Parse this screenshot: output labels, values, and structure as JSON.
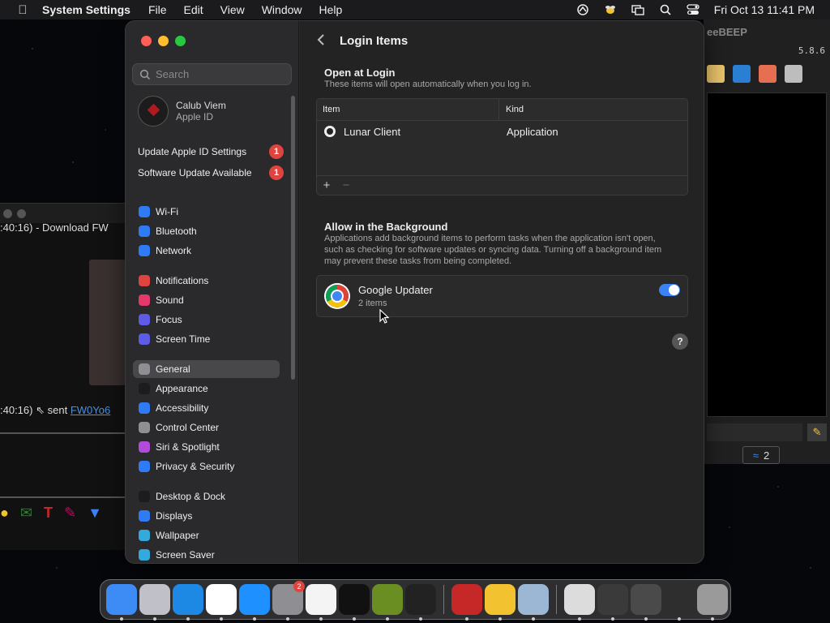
{
  "menubar": {
    "app_name": "System Settings",
    "menus": [
      "File",
      "Edit",
      "View",
      "Window",
      "Help"
    ],
    "clock": "Fri Oct 13  11:41 PM"
  },
  "background": {
    "left_window_line1": ":40:16)  -  Download FW",
    "left_window_line2_prefix": ":40:16)  ",
    "left_window_line2_sent": "sent ",
    "left_window_line2_link": "FW0Yo6",
    "right_window_title": "eeBEEP",
    "right_window_version": "5.8.6",
    "right_window_badge": "2"
  },
  "sidebar": {
    "search_placeholder": "Search",
    "user_name": "Calub Viem",
    "user_sub": "Apple ID",
    "notifications": [
      {
        "label": "Update Apple ID Settings",
        "count": "1"
      },
      {
        "label": "Software Update Available",
        "count": "1"
      }
    ],
    "items": [
      {
        "label": "Wi-Fi",
        "icon": "wifi-icon",
        "color": "#2f7bf6"
      },
      {
        "label": "Bluetooth",
        "icon": "bluetooth-icon",
        "color": "#2f7bf6"
      },
      {
        "label": "Network",
        "icon": "globe-icon",
        "color": "#2f7bf6"
      },
      {
        "label": "Notifications",
        "icon": "bell-icon",
        "color": "#e0443e"
      },
      {
        "label": "Sound",
        "icon": "speaker-icon",
        "color": "#e5396b"
      },
      {
        "label": "Focus",
        "icon": "moon-icon",
        "color": "#5e5ce6"
      },
      {
        "label": "Screen Time",
        "icon": "hourglass-icon",
        "color": "#5e5ce6"
      },
      {
        "label": "General",
        "icon": "gear-icon",
        "color": "#8e8e93"
      },
      {
        "label": "Appearance",
        "icon": "appearance-icon",
        "color": "#1c1c1e"
      },
      {
        "label": "Accessibility",
        "icon": "accessibility-icon",
        "color": "#2f7bf6"
      },
      {
        "label": "Control Center",
        "icon": "control-center-icon",
        "color": "#8e8e93"
      },
      {
        "label": "Siri & Spotlight",
        "icon": "siri-icon",
        "color": "#b04cd9"
      },
      {
        "label": "Privacy & Security",
        "icon": "hand-icon",
        "color": "#2f7bf6"
      },
      {
        "label": "Desktop & Dock",
        "icon": "dock-icon",
        "color": "#1c1c1e"
      },
      {
        "label": "Displays",
        "icon": "display-icon",
        "color": "#2f7bf6"
      },
      {
        "label": "Wallpaper",
        "icon": "wallpaper-icon",
        "color": "#34aadc"
      },
      {
        "label": "Screen Saver",
        "icon": "screensaver-icon",
        "color": "#34aadc"
      }
    ],
    "selected": "General"
  },
  "content": {
    "page_title": "Login Items",
    "open_at_login": {
      "title": "Open at Login",
      "description": "These items will open automatically when you log in.",
      "columns": [
        "Item",
        "Kind"
      ],
      "rows": [
        {
          "item": "Lunar Client",
          "kind": "Application"
        }
      ],
      "add_label": "+",
      "remove_label": "−"
    },
    "background": {
      "title": "Allow in the Background",
      "description": "Applications add background items to perform tasks when the application isn't open, such as checking for software updates or syncing data. Turning off a background item may prevent these tasks from being completed.",
      "item_name": "Google Updater",
      "item_sub": "2 items",
      "enabled": true
    },
    "help_label": "?"
  },
  "dock": {
    "apps": [
      {
        "name": "finder-icon",
        "color": "#3d8bf5"
      },
      {
        "name": "launchpad-icon",
        "color": "#c0c0c8"
      },
      {
        "name": "safari-icon",
        "color": "#1e88e5"
      },
      {
        "name": "chrome-icon",
        "color": "#ffffff"
      },
      {
        "name": "app-store-icon",
        "color": "#1e90ff"
      },
      {
        "name": "system-settings-icon",
        "color": "#8e8e93",
        "badge": "2"
      },
      {
        "name": "textedit-icon",
        "color": "#f4f4f4"
      },
      {
        "name": "terminal-icon",
        "color": "#111111"
      },
      {
        "name": "minecraft-icon",
        "color": "#6b8e23"
      },
      {
        "name": "lunar-client-icon",
        "color": "#222222"
      }
    ],
    "recent": [
      {
        "name": "filezilla-icon",
        "color": "#c62828"
      },
      {
        "name": "beebeep-icon",
        "color": "#f2c230"
      },
      {
        "name": "network-utility-icon",
        "color": "#9bb7d4"
      }
    ],
    "stack": [
      {
        "name": "document-stack-1-icon",
        "color": "#dcdcdc"
      },
      {
        "name": "document-stack-2-icon",
        "color": "#3a3a3a"
      },
      {
        "name": "document-stack-3-icon",
        "color": "#4a4a4a"
      },
      {
        "name": "document-stack-4-icon",
        "color": "#2e2e2e"
      },
      {
        "name": "trash-icon",
        "color": "#9a9a9a"
      }
    ]
  }
}
